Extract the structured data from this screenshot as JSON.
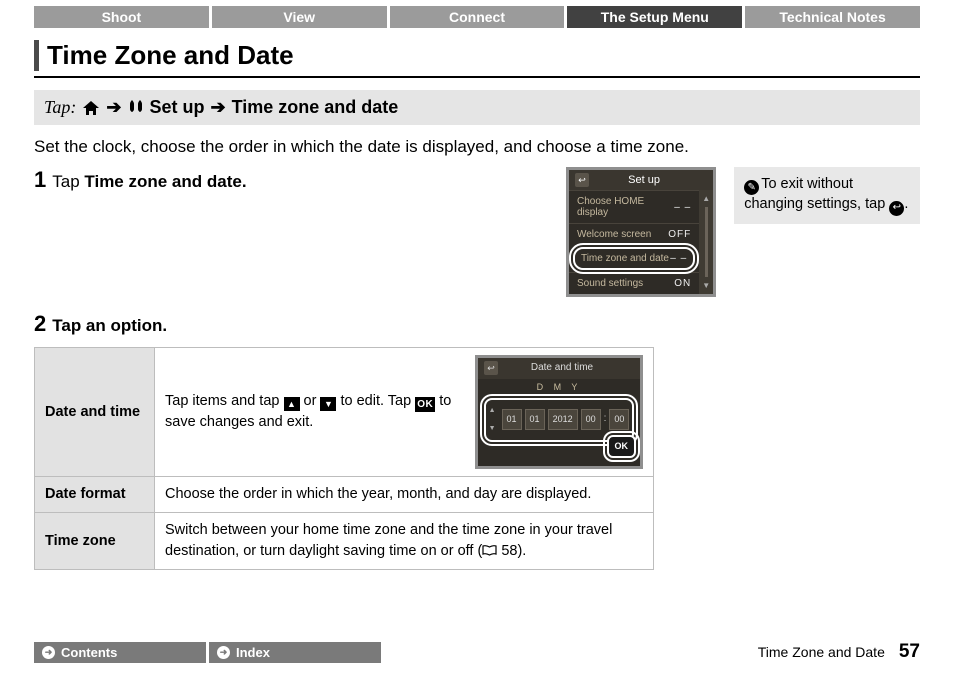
{
  "tabs": [
    "Shoot",
    "View",
    "Connect",
    "The Setup Menu",
    "Technical Notes"
  ],
  "active_tab": 3,
  "page_title": "Time Zone and Date",
  "tap_path": {
    "prefix": "Tap:",
    "setup": "Set up",
    "item": "Time zone and date"
  },
  "intro": "Set the clock, choose the order in which the date is displayed, and choose a time zone.",
  "step1": {
    "num": "1",
    "text": "Tap ",
    "bold": "Time zone and date."
  },
  "step2": {
    "num": "2",
    "text": "Tap an option."
  },
  "sidebox": {
    "pre": "To exit without changing settings, tap ",
    "post": "."
  },
  "cam1": {
    "title": "Set up",
    "rows": [
      {
        "label": "Choose HOME display",
        "val": "– –"
      },
      {
        "label": "Welcome screen",
        "val": "OFF"
      },
      {
        "label": "Time zone and date",
        "val": "– –",
        "sel": true
      },
      {
        "label": "Sound settings",
        "val": "ON"
      }
    ]
  },
  "options": [
    {
      "name": "Date and time",
      "desc_a": "Tap items and tap ",
      "desc_b": " or ",
      "desc_c": " to edit. Tap ",
      "desc_d": " to save changes and exit."
    },
    {
      "name": "Date format",
      "desc": "Choose the order in which the year, month, and day are displayed."
    },
    {
      "name": "Time zone",
      "desc_a": "Switch between your home time zone and the time zone in your travel destination, or turn daylight saving time on or off (",
      "desc_b": " 58)."
    }
  ],
  "dt": {
    "title": "Date and time",
    "dmy": "D M Y",
    "fields": [
      "01",
      "01",
      "2012",
      "00",
      "00"
    ],
    "ok": "OK"
  },
  "footer": {
    "contents": "Contents",
    "index": "Index",
    "section": "Time Zone and Date",
    "page": "57"
  }
}
